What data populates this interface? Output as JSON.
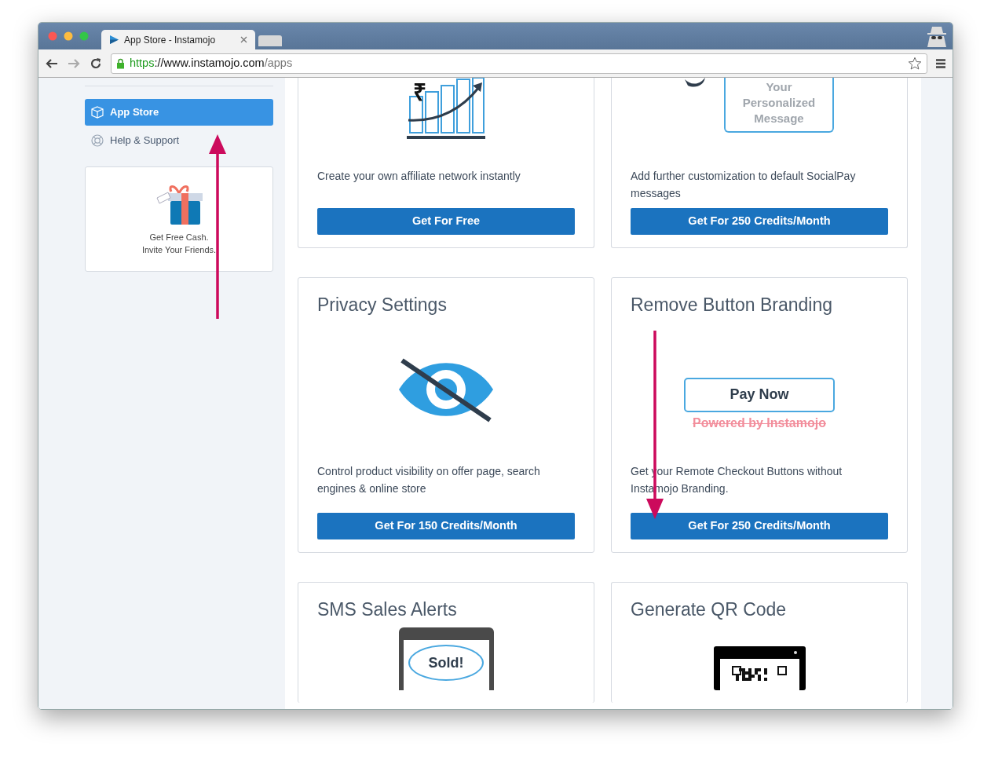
{
  "window": {
    "tab_title": "App Store - Instamojo",
    "url": {
      "scheme": "https",
      "host": "://www.instamojo.com",
      "path": "/apps"
    }
  },
  "sidebar": {
    "items": [
      {
        "label": "App Store",
        "kind": "cube",
        "selected": true
      },
      {
        "label": "Help & Support",
        "kind": "lifebuoy",
        "selected": false
      }
    ],
    "promo": {
      "lines": [
        "Get Free Cash.",
        "Invite Your Friends."
      ]
    }
  },
  "cards": [
    {
      "kind": "affiliate",
      "symbol": "₹",
      "description": "Create your own affiliate network instantly",
      "button": "Get For Free"
    },
    {
      "kind": "message",
      "message_lines": [
        "Your",
        "Personalized",
        "Message"
      ],
      "description": "Add further customization to default SocialPay messages",
      "button": "Get For 250 Credits/Month"
    },
    {
      "kind": "privacy",
      "title": "Privacy Settings",
      "description": "Control product visibility on offer page, search engines & online store",
      "button": "Get For 150 Credits/Month"
    },
    {
      "kind": "paynow",
      "title": "Remove Button Branding",
      "pay_button": "Pay Now",
      "struck_text": "Powered by Instamojo",
      "description": "Get your Remote Checkout Buttons without Instamojo Branding.",
      "button": "Get For 250 Credits/Month"
    },
    {
      "kind": "sms",
      "title": "SMS Sales Alerts",
      "bubble": "Sold!"
    },
    {
      "kind": "qr",
      "title": "Generate QR Code"
    }
  ]
}
